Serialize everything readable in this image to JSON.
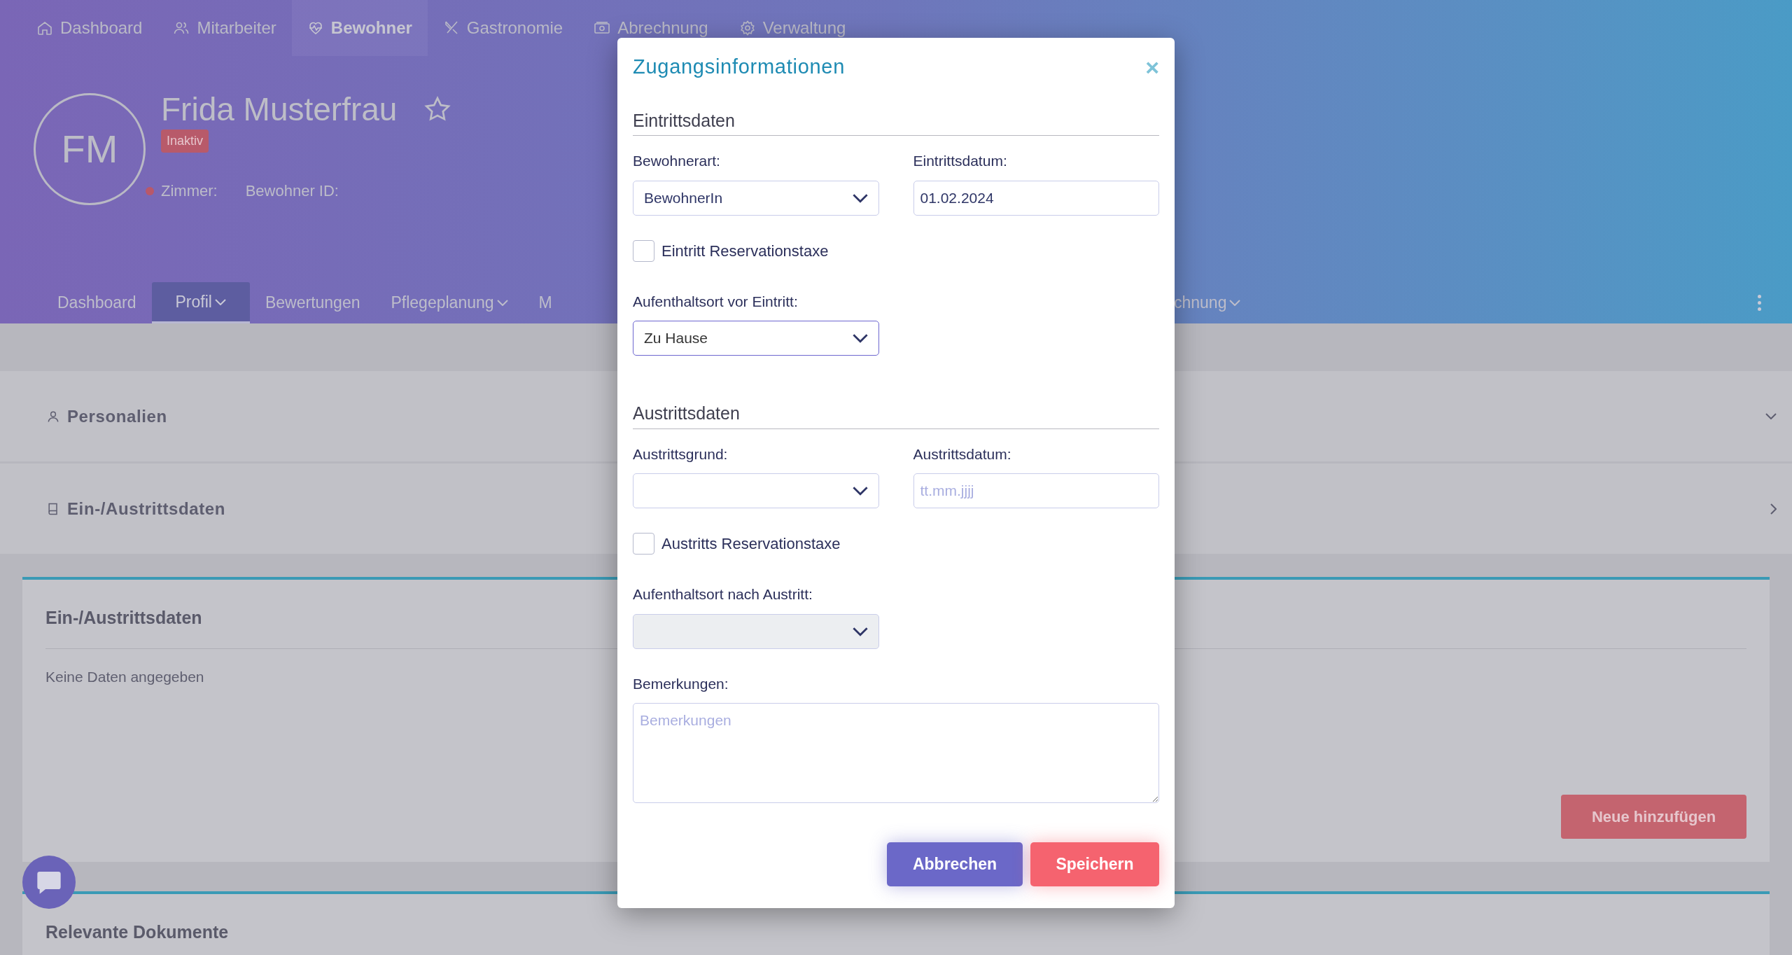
{
  "top_nav": [
    {
      "label": "Dashboard",
      "selected": false
    },
    {
      "label": "Mitarbeiter",
      "selected": false
    },
    {
      "label": "Bewohner",
      "selected": true
    },
    {
      "label": "Gastronomie",
      "selected": false
    },
    {
      "label": "Abrechnung",
      "selected": false
    },
    {
      "label": "Verwaltung",
      "selected": false
    }
  ],
  "profile": {
    "initials": "FM",
    "name": "Frida Musterfrau",
    "favorite": false,
    "status_badge": "Inaktiv",
    "fields": [
      "Zimmer:",
      "Bewohner ID:"
    ]
  },
  "sub_nav": [
    {
      "label": "Dashboard",
      "selected": false,
      "dropdown": false
    },
    {
      "label": "Profil",
      "selected": true,
      "dropdown": true
    },
    {
      "label": "Bewertungen",
      "selected": false,
      "dropdown": false
    },
    {
      "label": "Pflegeplanung",
      "selected": false,
      "dropdown": true
    },
    {
      "label": "M",
      "selected": false,
      "dropdown": false
    },
    {
      "label": "chnung",
      "selected": false,
      "dropdown": true
    }
  ],
  "accordion": [
    {
      "label": "Personalien",
      "expanded": true
    },
    {
      "label": "Ein-/Austrittsdaten",
      "expanded": false
    }
  ],
  "cards": [
    {
      "title": "Ein-/Austrittsdaten",
      "empty_text": "Keine Daten angegeben",
      "button": "Neue hinzufügen"
    },
    {
      "title": "Relevante Dokumente"
    }
  ],
  "modal": {
    "title": "Zugangsinformationen",
    "close": "×",
    "sections": [
      {
        "heading": "Eintrittsdaten",
        "fields": [
          {
            "kind": "select",
            "label": "Bewohnerart:",
            "value": "BewohnerIn",
            "focused": false,
            "disabled": false
          },
          {
            "kind": "date",
            "label": "Eintrittsdatum:",
            "value": "01.02.2024"
          },
          {
            "kind": "checkbox",
            "label": "Eintritt Reservationstaxe",
            "checked": false
          },
          {
            "kind": "select",
            "label": "Aufenthaltsort vor Eintritt:",
            "value": "Zu Hause",
            "focused": true,
            "disabled": false
          }
        ]
      },
      {
        "heading": "Austrittsdaten",
        "fields": [
          {
            "kind": "select",
            "label": "Austrittsgrund:",
            "focused": false,
            "disabled": false
          },
          {
            "kind": "date",
            "label": "Austrittsdatum:",
            "placeholder": "tt.mm.jjjj"
          },
          {
            "kind": "checkbox",
            "label": "Austritts Reservationstaxe",
            "checked": false
          },
          {
            "kind": "select",
            "label": "Aufenthaltsort nach Austritt:",
            "focused": false,
            "disabled": true
          },
          {
            "kind": "textarea",
            "label": "Bemerkungen:",
            "placeholder": "Bemerkungen"
          }
        ]
      }
    ],
    "buttons": [
      {
        "label": "Abbrechen",
        "kind": "secondary"
      },
      {
        "label": "Speichern",
        "kind": "primary"
      }
    ]
  }
}
